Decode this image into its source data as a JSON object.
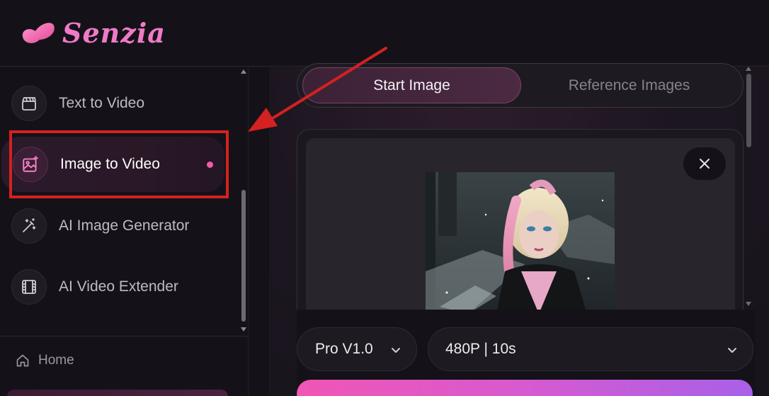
{
  "brand": {
    "name": "Senzia",
    "accent": "#f07ac8"
  },
  "sidebar": {
    "items": [
      {
        "label": "Text to Video",
        "icon": "clapperboard-icon",
        "active": false
      },
      {
        "label": "Image to Video",
        "icon": "image-sparkle-icon",
        "active": true
      },
      {
        "label": "AI Image Generator",
        "icon": "magic-wand-icon",
        "active": false
      },
      {
        "label": "AI Video Extender",
        "icon": "film-strip-icon",
        "active": false
      }
    ],
    "home_label": "Home"
  },
  "tabs": [
    {
      "label": "Start Image",
      "active": true
    },
    {
      "label": "Reference Images",
      "active": false
    }
  ],
  "controls": {
    "model": "Pro V1.0",
    "resolution_duration": "480P | 10s"
  },
  "annotation": {
    "color": "#d42121"
  }
}
